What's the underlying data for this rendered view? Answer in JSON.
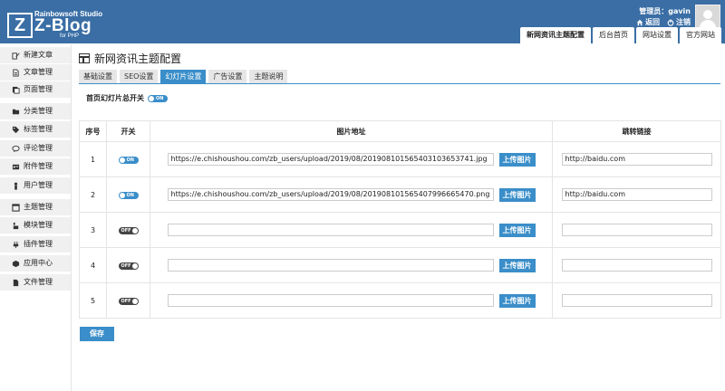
{
  "brand": {
    "studio": "Rainbowsoft Studio",
    "name": "Z-Blog",
    "sub": "for PHP",
    "letter": "Z"
  },
  "user": {
    "label": "管理员：gavin",
    "back": "返回",
    "logout": "注销"
  },
  "top_tabs": [
    {
      "label": "新网资讯主题配置",
      "active": true
    },
    {
      "label": "后台首页"
    },
    {
      "label": "网站设置"
    },
    {
      "label": "官方网站"
    }
  ],
  "sidebar": {
    "items": [
      {
        "label": "新建文章",
        "icon": "pencil-icon"
      },
      {
        "label": "文章管理",
        "icon": "document-icon"
      },
      {
        "label": "页面管理",
        "icon": "pages-icon"
      },
      {
        "label": "分类管理",
        "icon": "folder-icon"
      },
      {
        "label": "标签管理",
        "icon": "tag-icon"
      },
      {
        "label": "评论管理",
        "icon": "comment-icon"
      },
      {
        "label": "附件管理",
        "icon": "attachment-icon"
      },
      {
        "label": "用户管理",
        "icon": "user-icon"
      },
      {
        "label": "主题管理",
        "icon": "theme-icon"
      },
      {
        "label": "模块管理",
        "icon": "module-icon"
      },
      {
        "label": "插件管理",
        "icon": "plugin-icon"
      },
      {
        "label": "应用中心",
        "icon": "app-center-icon"
      },
      {
        "label": "文件管理",
        "icon": "file-icon"
      }
    ]
  },
  "page": {
    "title": "新网资讯主题配置"
  },
  "subtabs": [
    {
      "label": "基础设置"
    },
    {
      "label": "SEO设置"
    },
    {
      "label": "幻灯片设置",
      "active": true
    },
    {
      "label": "广告设置"
    },
    {
      "label": "主题说明"
    }
  ],
  "master_switch": {
    "label": "首页幻灯片总开关",
    "state": "ON"
  },
  "table": {
    "headers": {
      "index": "序号",
      "toggle": "开关",
      "image": "图片地址",
      "link": "跳转链接"
    },
    "upload_label": "上传图片",
    "rows": [
      {
        "index": "1",
        "toggle": "ON",
        "image_url": "https://e.chishoushou.com/zb_users/upload/2019/08/201908101565403103653741.jpg",
        "link": "http://baidu.com"
      },
      {
        "index": "2",
        "toggle": "ON",
        "image_url": "https://e.chishoushou.com/zb_users/upload/2019/08/201908101565407996665470.png",
        "link": "http://baidu.com"
      },
      {
        "index": "3",
        "toggle": "OFF",
        "image_url": "",
        "link": ""
      },
      {
        "index": "4",
        "toggle": "OFF",
        "image_url": "",
        "link": ""
      },
      {
        "index": "5",
        "toggle": "OFF",
        "image_url": "",
        "link": ""
      }
    ]
  },
  "save_label": "保存",
  "colors": {
    "header": "#3a6ea5",
    "accent": "#3a8ec9"
  }
}
